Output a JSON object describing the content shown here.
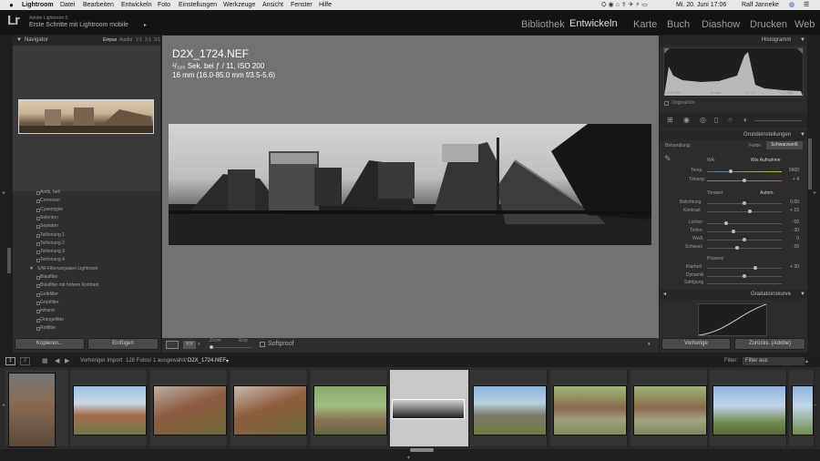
{
  "menubar": {
    "app": "Lightroom",
    "items": [
      "Datei",
      "Bearbeiten",
      "Entwickeln",
      "Foto",
      "Einstellungen",
      "Werkzeuge",
      "Ansicht",
      "Fenster",
      "Hilfe"
    ],
    "datetime": "Mi. 20. Juni 17:06",
    "user": "Ralf Janneke"
  },
  "identity": {
    "logo": "Lr",
    "product": "Adobe Lightroom 5",
    "subtitle": "Erste Schritte mit Lightroom mobile"
  },
  "modules": [
    "Bibliothek",
    "Entwickeln",
    "Karte",
    "Buch",
    "Diashow",
    "Drucken",
    "Web"
  ],
  "navigator": {
    "title": "Navigator",
    "zoom": [
      "Einpas",
      "Ausfül",
      "1:1",
      "2:1",
      "3:1"
    ]
  },
  "presets": {
    "items": [
      "Antik, hell",
      "Cremeton",
      "Cyanotypie",
      "Selenton",
      "Sepiaton",
      "Teiltonung 1",
      "Teiltonung 2",
      "Teiltonung 3",
      "Teiltonung 4"
    ],
    "folder": "S/W-Filtervorgaben Lightroom",
    "folder_items": [
      "Blaufilter",
      "Blaufilter mit hohem Kontrast",
      "Gelbfilter",
      "Grünfilter",
      "Infrarot",
      "Orangefilter",
      "Rotfilter"
    ]
  },
  "left_buttons": {
    "copy": "Kopieren...",
    "paste": "Einfügen"
  },
  "image_info": {
    "filename": "D2X_1724.NEF",
    "exposure": "¹/₃₂₀ Sek. bei ƒ / 11, ISO 200",
    "lens": "16 mm (16.0-85.0 mm f/3.5-5.6)"
  },
  "toolbar": {
    "zoom_label": "Zoom",
    "zoom_value": "Einp.",
    "softproof": "Softproof"
  },
  "histogram": {
    "title": "Histogramm",
    "iso": "ISO 200",
    "focal": "16 mm",
    "aperture": "ƒ / 11",
    "shutter": "¹/₃₂₀ Sek.",
    "original": "Originalfoto"
  },
  "basic": {
    "title": "Grundeinstellungen",
    "treatment_label": "Behandlung:",
    "color": "Farbe",
    "bw": "Schwarzweiß",
    "wb": "WA:",
    "wb_value": "Wie Aufnahme",
    "temp": "Temp.",
    "temp_val": "5000",
    "tint": "Tönung",
    "tint_val": "+ 4",
    "tone": "Tonwert",
    "auto": "Autom.",
    "exposure": "Belichtung",
    "exposure_val": "0,00",
    "contrast": "Kontrast",
    "contrast_val": "+ 15",
    "highlights": "Lichter",
    "highlights_val": "- 50",
    "shadows": "Tiefen",
    "shadows_val": "- 30",
    "whites": "Weiß",
    "whites_val": "0",
    "blacks": "Schwarz",
    "blacks_val": "- 20",
    "presence": "Präsenz",
    "clarity": "Klarheit",
    "clarity_val": "+ 30",
    "vibrance": "Dynamik",
    "saturation": "Sättigung"
  },
  "tone_curve": {
    "title": "Gradationskurve"
  },
  "right_buttons": {
    "previous": "Vorherige",
    "reset": "Zurücks. (Adobe)"
  },
  "filmstrip_bar": {
    "source": "Vorheriger Import",
    "count": "128 Fotos/ 1 ausgewählt/",
    "selected_file": "D2X_1724.NEF",
    "filter_label": "Filter:",
    "filter_value": "Filter aus"
  }
}
